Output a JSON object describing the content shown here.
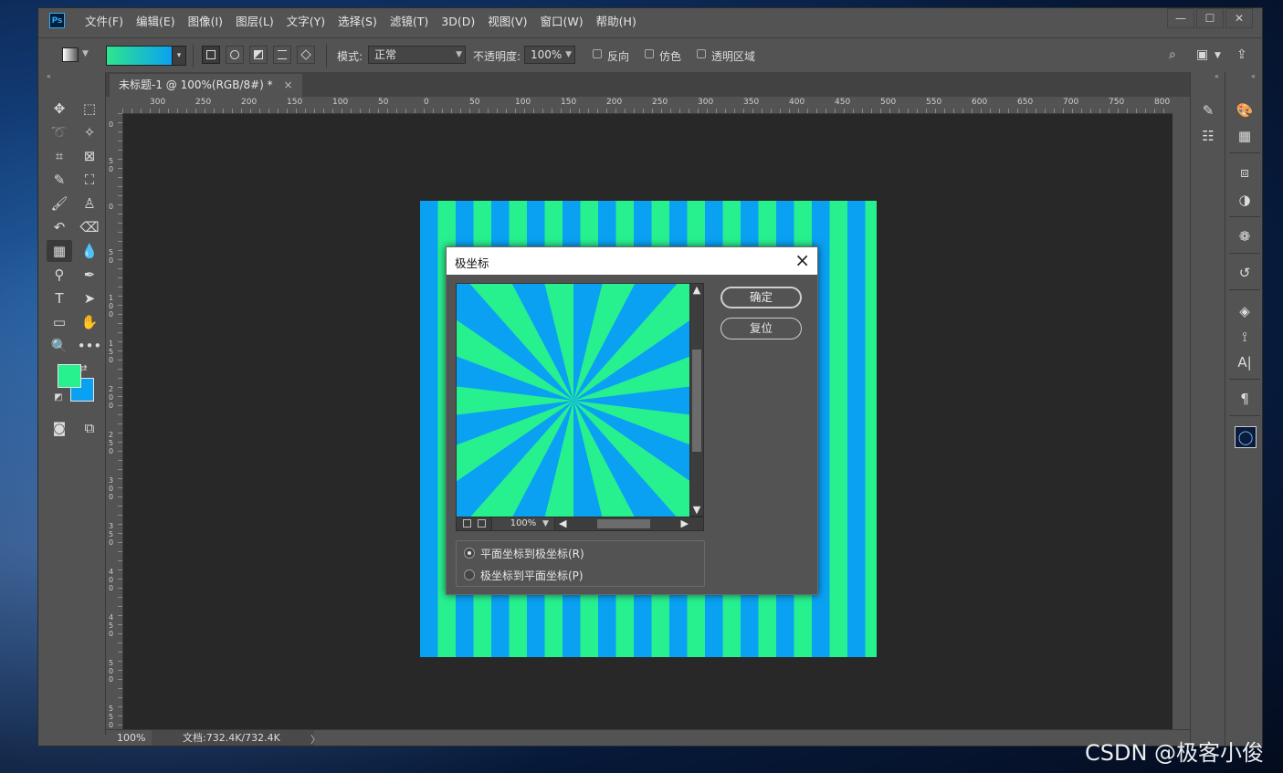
{
  "app": {
    "logo": "Ps"
  },
  "menu": [
    "文件(F)",
    "编辑(E)",
    "图像(I)",
    "图层(L)",
    "文字(Y)",
    "选择(S)",
    "滤镜(T)",
    "3D(D)",
    "视图(V)",
    "窗口(W)",
    "帮助(H)"
  ],
  "window_controls": [
    "—",
    "☐",
    "✕"
  ],
  "options": {
    "mode_label": "模式:",
    "mode_value": "正常",
    "opacity_label": "不透明度:",
    "opacity_value": "100%",
    "reverse_label": "反向",
    "dither_label": "仿色",
    "transparency_label": "透明区域",
    "gradient_colors": [
      "#27f08f",
      "#0aa1f3"
    ]
  },
  "document_tab": {
    "title": "未标题-1 @ 100%(RGB/8#) *",
    "close": "×"
  },
  "ruler_h": [
    "300",
    "250",
    "200",
    "150",
    "100",
    "50",
    "0",
    "50",
    "100",
    "150",
    "200",
    "250",
    "300",
    "350",
    "400",
    "450",
    "500",
    "550",
    "600",
    "650",
    "700",
    "750",
    "800"
  ],
  "ruler_v": [
    "0",
    "50",
    "0",
    "50",
    "100",
    "150",
    "200",
    "250",
    "300",
    "350",
    "400",
    "450",
    "500",
    "550"
  ],
  "colors": {
    "foreground": "#27f08f",
    "background": "#0aa1f3"
  },
  "status": {
    "zoom": "100%",
    "doc_size": "文档:732.4K/732.4K",
    "arrow": "〉"
  },
  "dialog": {
    "title": "极坐标",
    "ok_label": "确定",
    "reset_label": "复位",
    "preview_zoom": "100%",
    "option1": "平面坐标到极坐标(R)",
    "option2": "极坐标到平面坐标(P)",
    "selected_option": 1,
    "ray_colors": [
      "#0aa1f3",
      "#27f08f"
    ]
  },
  "watermark": "CSDN @极客小俊"
}
